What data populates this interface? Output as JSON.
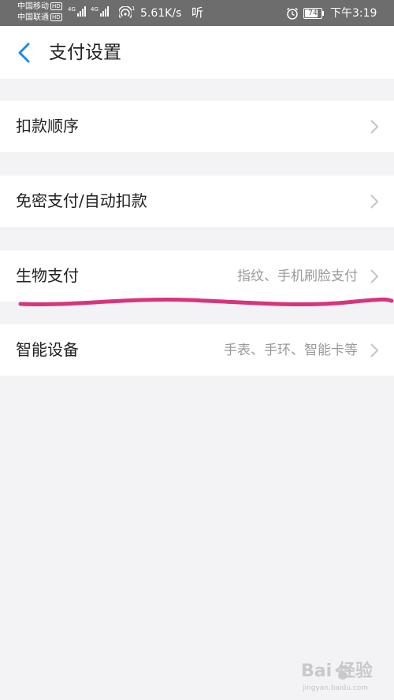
{
  "status_bar": {
    "carrier_1": "中国移动",
    "carrier_2": "中国联通",
    "hd_badge": "HD",
    "network_1": "4G",
    "network_2": "4G",
    "wifi_sup": "1",
    "speed": "5.61K/s",
    "ear_icon": "听",
    "battery": "74",
    "time": "下午3:19"
  },
  "nav": {
    "title": "支付设置",
    "back_icon": "chevron-left-icon"
  },
  "rows": [
    {
      "label": "扣款顺序",
      "sub": ""
    },
    {
      "label": "免密支付/自动扣款",
      "sub": ""
    },
    {
      "label": "生物支付",
      "sub": "指纹、手机刷脸支付"
    },
    {
      "label": "智能设备",
      "sub": "手表、手环、智能卡等"
    }
  ],
  "annotation": {
    "color": "#d6357e"
  },
  "watermark": {
    "main": "Bai  经验",
    "site": "jingyan.baidu.com"
  },
  "colors": {
    "accent": "#1e8be0",
    "status_bar": "#6d6d6d",
    "background": "#f3f3f5"
  }
}
